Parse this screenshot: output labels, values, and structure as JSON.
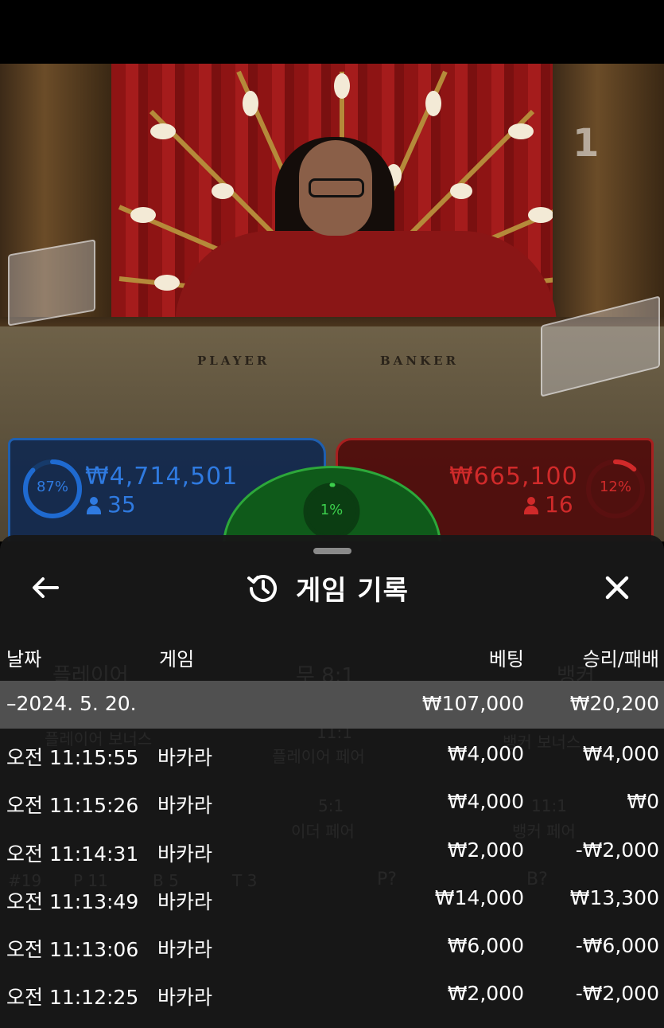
{
  "video": {
    "table_number": "1",
    "table_labels": {
      "player": "PLAYER",
      "banker": "BANKER"
    },
    "player_bet": {
      "percent_label": "87%",
      "percent": 87,
      "amount": "₩4,714,501",
      "count": "35",
      "color": "#1f6ad0"
    },
    "banker_bet": {
      "percent_label": "12%",
      "percent": 12,
      "amount": "₩665,100",
      "count": "16",
      "color": "#c02020"
    },
    "tie_bet": {
      "percent_label": "1%",
      "percent": 1,
      "color": "#2da83a"
    }
  },
  "background_ghost": {
    "labels": [
      "플레이어",
      "무 8:1",
      "뱅커",
      "플레이어 보너스",
      "11:1",
      "플레이어 페어",
      "뱅커 보너스",
      "5:1",
      "이더 페어",
      "11:1",
      "뱅커 페어",
      "#19",
      "P 11",
      "B 5",
      "T 3",
      "P?",
      "B?"
    ]
  },
  "history": {
    "title": "게임 기록",
    "icons": {
      "back": "back-arrow-icon",
      "history": "history-clock-icon",
      "close": "close-icon"
    },
    "columns": {
      "date": "날짜",
      "game": "게임",
      "bet": "베팅",
      "win_loss": "승리/패배"
    },
    "summary": {
      "date": "–2024. 5. 20.",
      "bet": "₩107,000",
      "win_loss": "₩20,200"
    },
    "rows": [
      {
        "time": "오전 11:15:55",
        "game": "바카라",
        "bet": "₩4,000",
        "win_loss": "₩4,000"
      },
      {
        "time": "오전 11:15:26",
        "game": "바카라",
        "bet": "₩4,000",
        "win_loss": "₩0"
      },
      {
        "time": "오전 11:14:31",
        "game": "바카라",
        "bet": "₩2,000",
        "win_loss": "-₩2,000"
      },
      {
        "time": "오전 11:13:49",
        "game": "바카라",
        "bet": "₩14,000",
        "win_loss": "₩13,300"
      },
      {
        "time": "오전 11:13:06",
        "game": "바카라",
        "bet": "₩6,000",
        "win_loss": "-₩6,000"
      },
      {
        "time": "오전 11:12:25",
        "game": "바카라",
        "bet": "₩2,000",
        "win_loss": "-₩2,000"
      }
    ]
  }
}
